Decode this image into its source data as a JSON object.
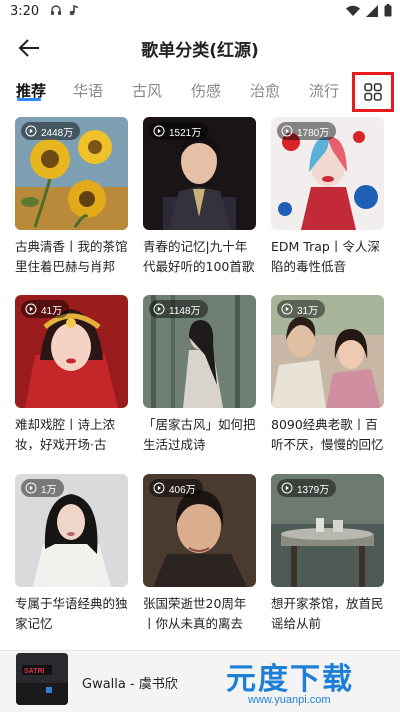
{
  "status_bar": {
    "time": "3:20"
  },
  "header": {
    "title": "歌单分类(红源)"
  },
  "tabs": [
    {
      "label": "推荐"
    },
    {
      "label": "华语"
    },
    {
      "label": "古风"
    },
    {
      "label": "伤感"
    },
    {
      "label": "治愈"
    },
    {
      "label": "流行"
    }
  ],
  "playlists": [
    {
      "plays": "2448万",
      "title": "古典清香丨我的茶馆里住着巴赫与肖邦"
    },
    {
      "plays": "1521万",
      "title": "青春的记忆|九十年代最好听的100首歌"
    },
    {
      "plays": "1780万",
      "title": "EDM Trap丨令人深陷的毒性低音"
    },
    {
      "plays": "41万",
      "title": "难却戏腔丨诗上浓妆，好戏开场·古风..."
    },
    {
      "plays": "1148万",
      "title": "「居家古风」如何把生活过成诗"
    },
    {
      "plays": "31万",
      "title": "8090经典老歌丨百听不厌，慢慢的回忆"
    },
    {
      "plays": "1万",
      "title": "专属于华语经典的独家记忆"
    },
    {
      "plays": "406万",
      "title": "张国荣逝世20周年丨你从未真的离去"
    },
    {
      "plays": "1379万",
      "title": "想开家茶馆，放首民谣给从前"
    }
  ],
  "player": {
    "track": "Gwalla - 虞书欣",
    "cover_text": "SATRI"
  },
  "watermark": {
    "main": "元度下载",
    "url": "www.yuanpi.com"
  },
  "colors": {
    "accent": "#2b8cff",
    "highlight_box": "#e81c1c",
    "watermark": "#1d7fd6"
  }
}
